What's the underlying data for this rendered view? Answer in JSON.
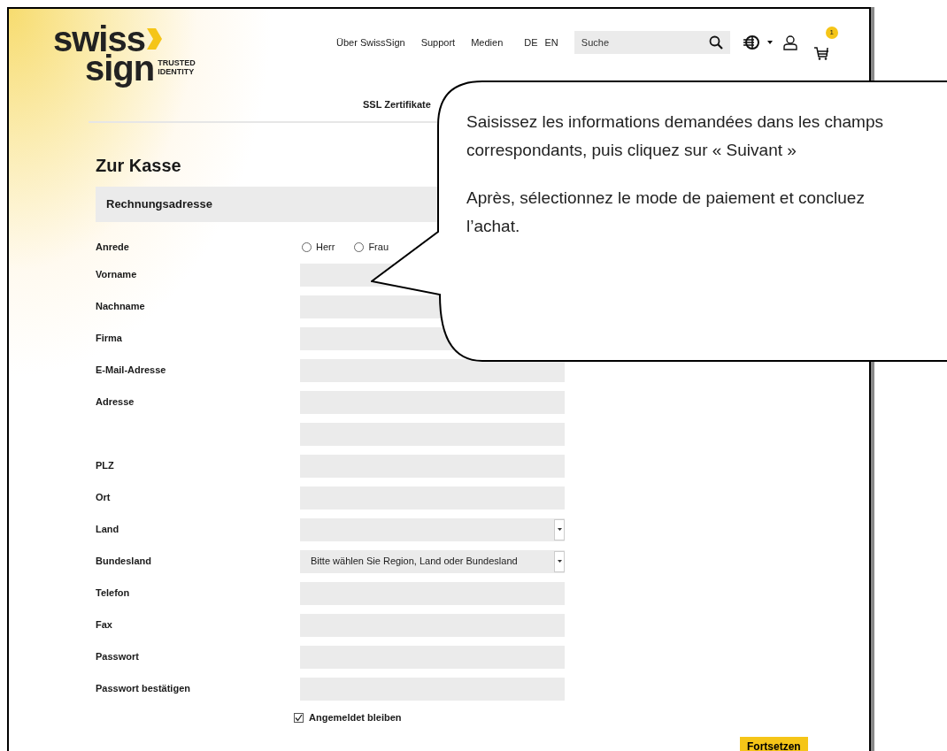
{
  "logo": {
    "line1": "swiss",
    "line2": "sign",
    "tagline": [
      "TRUSTED",
      "IDENTITY"
    ]
  },
  "nav": [
    "Über SwissSign",
    "Support",
    "Medien"
  ],
  "languages": [
    "DE",
    "EN"
  ],
  "search": {
    "placeholder": "Suche"
  },
  "cart_count": "1",
  "subnav": [
    "SSL Zertifikate"
  ],
  "title": "Zur Kasse",
  "section": "Rechnungsadresse",
  "form": [
    {
      "kind": "radio",
      "label": "Anrede",
      "options": [
        {
          "label": "Herr",
          "selected": false
        },
        {
          "label": "Frau",
          "selected": false
        }
      ]
    },
    {
      "kind": "text",
      "label": "Vorname"
    },
    {
      "kind": "text",
      "label": "Nachname"
    },
    {
      "kind": "text",
      "label": "Firma"
    },
    {
      "kind": "text",
      "label": "E-Mail-Adresse"
    },
    {
      "kind": "text",
      "label": "Adresse"
    },
    {
      "kind": "text"
    },
    {
      "kind": "text",
      "label": "PLZ"
    },
    {
      "kind": "text",
      "label": "Ort"
    },
    {
      "kind": "select",
      "label": "Land"
    },
    {
      "kind": "select",
      "label": "Bundesland",
      "value": "Bitte wählen Sie Region, Land oder Bundesland"
    },
    {
      "kind": "text",
      "label": "Telefon"
    },
    {
      "kind": "text",
      "label": "Fax"
    },
    {
      "kind": "text",
      "label": "Passwort"
    },
    {
      "kind": "text",
      "label": "Passwort bestätigen"
    },
    {
      "kind": "checkbox",
      "label": "Angemeldet bleiben",
      "checked": true
    }
  ],
  "buttons": [
    "Fortsetzen"
  ],
  "callout": {
    "paragraphs": [
      "Saisissez les informations demandées dans les champs correspondants, puis cliquez sur « Suivant »",
      "Après, sélectionnez le mode de paiement et concluez l’achat."
    ]
  }
}
